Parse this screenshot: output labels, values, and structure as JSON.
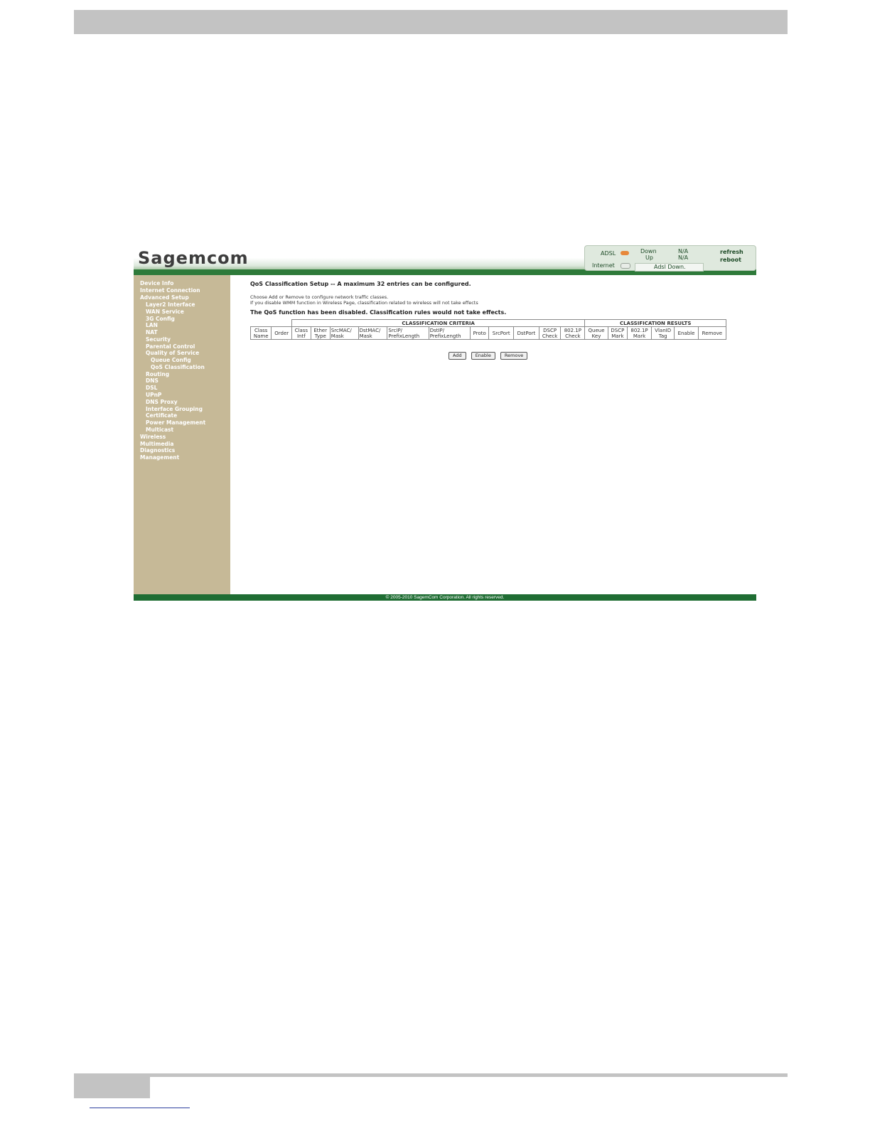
{
  "brand": {
    "logo_text": "Sagemcom"
  },
  "status": {
    "adsl_label": "ADSL",
    "internet_label": "Internet",
    "down_label": "Down",
    "down_value": "N/A",
    "up_label": "Up",
    "up_value": "N/A",
    "message": "Adsl Down.",
    "refresh_link": "refresh",
    "reboot_link": "reboot",
    "adsl_led_color": "#e7883a",
    "internet_led_color": "#e8ece7"
  },
  "sidebar": {
    "items": [
      {
        "label": "Device Info"
      },
      {
        "label": "Internet Connection"
      },
      {
        "label": "Advanced Setup"
      },
      {
        "label": "Layer2 Interface"
      },
      {
        "label": "WAN Service"
      },
      {
        "label": "3G Config"
      },
      {
        "label": "LAN"
      },
      {
        "label": "NAT"
      },
      {
        "label": "Security"
      },
      {
        "label": "Parental Control"
      },
      {
        "label": "Quality of Service"
      },
      {
        "label": "Queue Config"
      },
      {
        "label": "QoS Classification"
      },
      {
        "label": "Routing"
      },
      {
        "label": "DNS"
      },
      {
        "label": "DSL"
      },
      {
        "label": "UPnP"
      },
      {
        "label": "DNS Proxy"
      },
      {
        "label": "Interface Grouping"
      },
      {
        "label": "Certificate"
      },
      {
        "label": "Power Management"
      },
      {
        "label": "Multicast"
      },
      {
        "label": "Wireless"
      },
      {
        "label": "Multimedia"
      },
      {
        "label": "Diagnostics"
      },
      {
        "label": "Management"
      }
    ]
  },
  "main": {
    "title": "QoS Classification Setup -- A maximum 32 entries can be configured.",
    "desc_line1": "Choose Add or Remove to configure network traffic classes.",
    "desc_line2": "If you disable WMM function in Wireless Page, classification related to wireless will not take effects",
    "warning": "The QoS function has been disabled. Classification rules would not take effects.",
    "table": {
      "group_criteria": "CLASSIFICATION CRITERIA",
      "group_results": "CLASSIFICATION RESULTS",
      "columns": [
        {
          "l1": "Class",
          "l2": "Name"
        },
        {
          "l1": "Order",
          "l2": ""
        },
        {
          "l1": "Class",
          "l2": "Intf"
        },
        {
          "l1": "Ether",
          "l2": "Type"
        },
        {
          "l1": "SrcMAC/",
          "l2": "Mask"
        },
        {
          "l1": "DstMAC/",
          "l2": "Mask"
        },
        {
          "l1": "SrcIP/",
          "l2": "PrefixLength"
        },
        {
          "l1": "DstIP/",
          "l2": "PrefixLength"
        },
        {
          "l1": "Proto",
          "l2": ""
        },
        {
          "l1": "SrcPort",
          "l2": ""
        },
        {
          "l1": "DstPort",
          "l2": ""
        },
        {
          "l1": "DSCP",
          "l2": "Check"
        },
        {
          "l1": "802.1P",
          "l2": "Check"
        },
        {
          "l1": "Queue",
          "l2": "Key"
        },
        {
          "l1": "DSCP",
          "l2": "Mark"
        },
        {
          "l1": "802.1P",
          "l2": "Mark"
        },
        {
          "l1": "VlanID",
          "l2": "Tag"
        },
        {
          "l1": "Enable",
          "l2": ""
        },
        {
          "l1": "Remove",
          "l2": ""
        }
      ]
    },
    "buttons": {
      "add": "Add",
      "enable": "Enable",
      "remove": "Remove"
    }
  },
  "footer": {
    "copyright": "© 2005-2010 SagemCom Corporation. All rights reserved."
  }
}
